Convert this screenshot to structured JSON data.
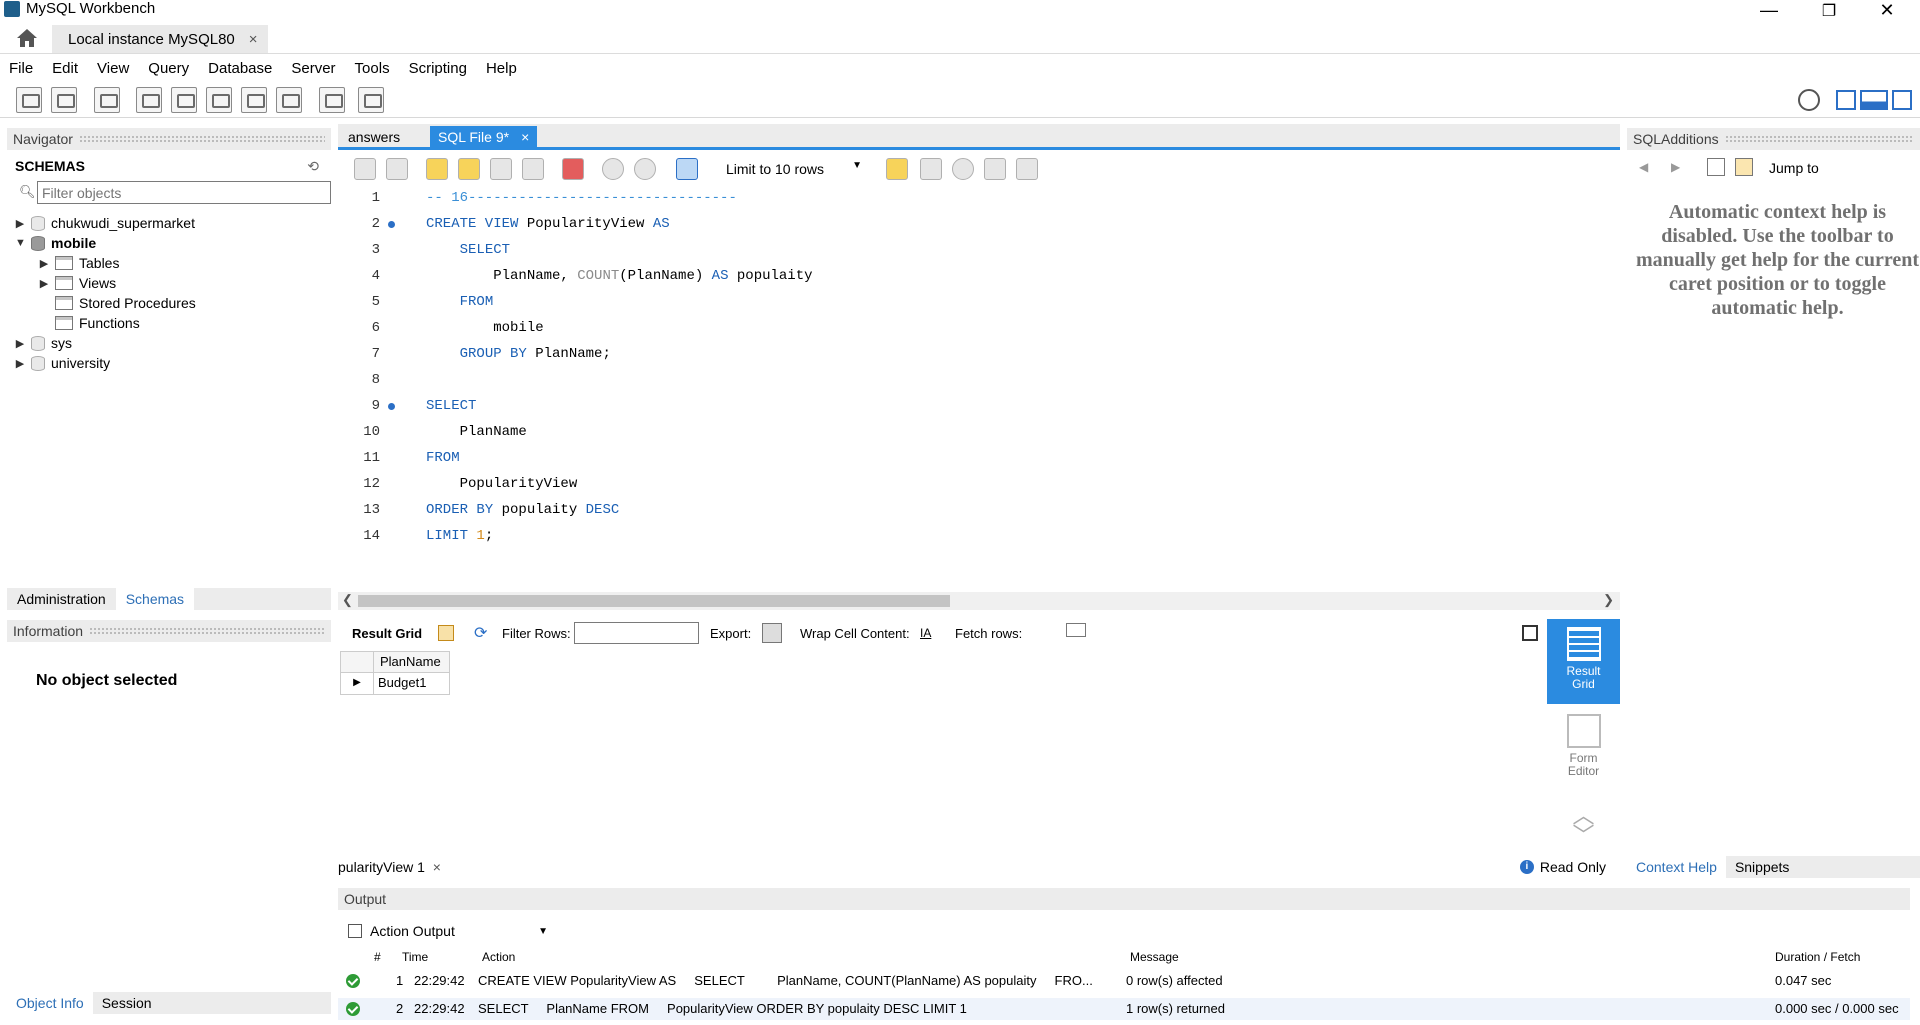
{
  "window": {
    "title": "MySQL Workbench",
    "minimize": "—",
    "maximize": "❐",
    "close": "✕"
  },
  "tabs": {
    "connection_tab": "Local instance MySQL80",
    "close": "×"
  },
  "menu": [
    "File",
    "Edit",
    "View",
    "Query",
    "Database",
    "Server",
    "Tools",
    "Scripting",
    "Help"
  ],
  "navigator": {
    "header": "Navigator",
    "schemas_title": "SCHEMAS",
    "filter_placeholder": "Filter objects",
    "tree": {
      "chukwudi": "chukwudi_supermarket",
      "mobile": "mobile",
      "tables": "Tables",
      "views": "Views",
      "stored_procedures": "Stored Procedures",
      "functions": "Functions",
      "sys": "sys",
      "university": "university"
    },
    "tabs": {
      "administration": "Administration",
      "schemas": "Schemas"
    }
  },
  "information": {
    "header": "Information",
    "no_object": "No object selected",
    "tab_object_info": "Object Info",
    "tab_session": "Session"
  },
  "editor": {
    "tabs": {
      "answers": "answers",
      "sql_file": "SQL File 9*"
    },
    "limit": "Limit to 10 rows",
    "lines": [
      "1",
      "2",
      "3",
      "4",
      "5",
      "6",
      "7",
      "8",
      "9",
      "10",
      "11",
      "12",
      "13",
      "14"
    ]
  },
  "result": {
    "result_grid_label": "Result Grid",
    "filter_rows_label": "Filter Rows:",
    "export_label": "Export:",
    "wrap_label": "Wrap Cell Content:",
    "fetch_label": "Fetch rows:",
    "column": "PlanName",
    "row_value": "Budget1",
    "side_result_grid": "Result\nGrid",
    "side_form_editor": "Form\nEditor",
    "result_tab": "pularityView 1",
    "read_only": "Read Only"
  },
  "output": {
    "header": "Output",
    "select": "Action Output",
    "columns": {
      "num": "#",
      "time": "Time",
      "action": "Action",
      "message": "Message",
      "duration": "Duration / Fetch"
    },
    "rows": [
      {
        "num": "1",
        "time": "22:29:42",
        "action": "CREATE VIEW PopularityView AS     SELECT         PlanName, COUNT(PlanName) AS populaity     FRO...",
        "message": "0 row(s) affected",
        "duration": "0.047 sec"
      },
      {
        "num": "2",
        "time": "22:29:42",
        "action": "SELECT     PlanName FROM     PopularityView ORDER BY populaity DESC LIMIT 1",
        "message": "1 row(s) returned",
        "duration": "0.000 sec / 0.000 sec"
      }
    ]
  },
  "sql_additions": {
    "header": "SQLAdditions",
    "jump_to": "Jump to",
    "help_text": "Automatic context help is disabled. Use the toolbar to manually get help for the current caret position or to toggle automatic help.",
    "tab_context_help": "Context Help",
    "tab_snippets": "Snippets"
  },
  "colors": {
    "accent": "#2b8be0",
    "keyword": "#1a5fb4",
    "ok": "#2e9b36"
  }
}
